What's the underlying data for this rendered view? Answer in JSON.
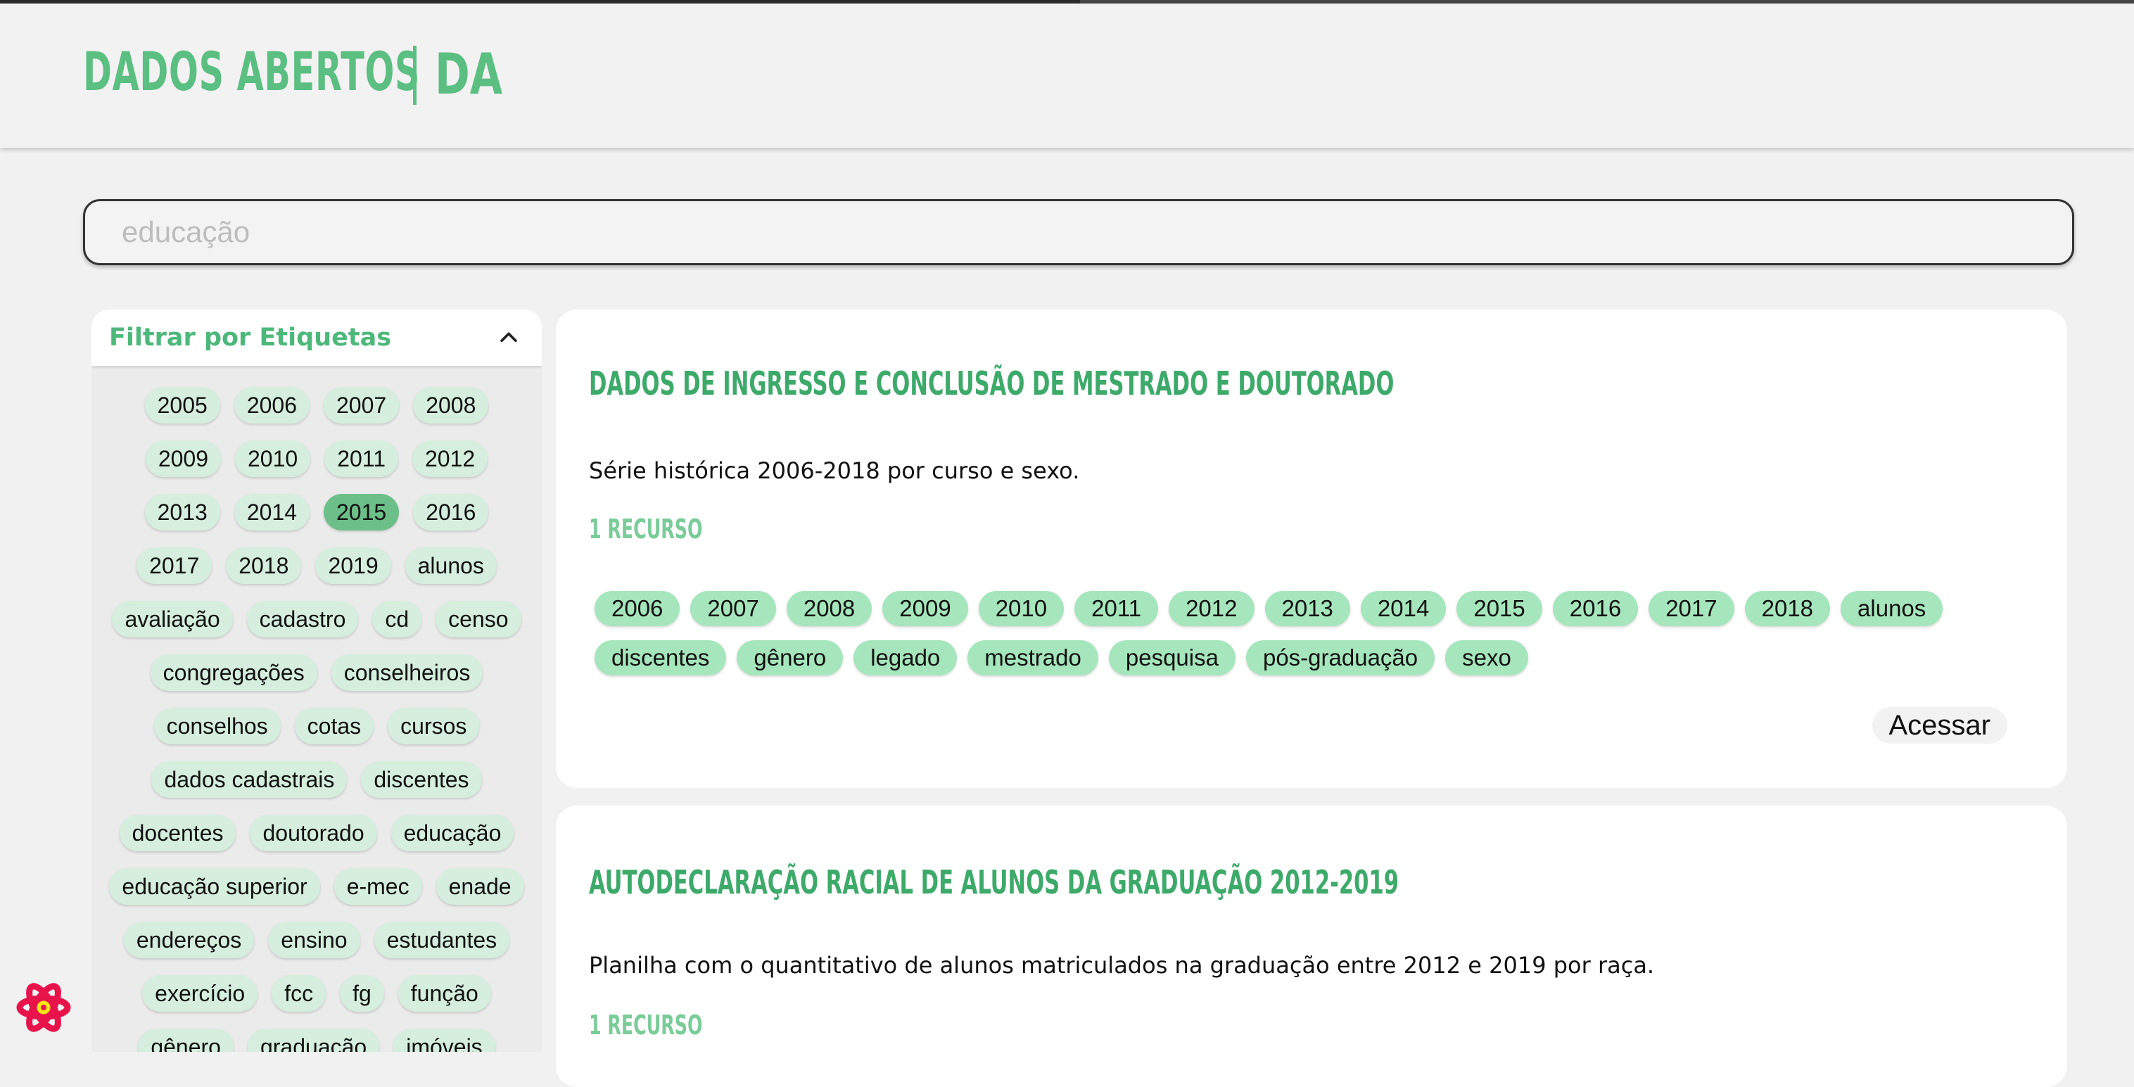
{
  "header": {
    "logo_text": "DADOS ABERTOS",
    "logo_mark": "DA"
  },
  "search": {
    "placeholder": "educação"
  },
  "filter": {
    "title": "Filtrar por Etiquetas",
    "active_tag": "2015",
    "tags": [
      "2005",
      "2006",
      "2007",
      "2008",
      "2009",
      "2010",
      "2011",
      "2012",
      "2013",
      "2014",
      "2015",
      "2016",
      "2017",
      "2018",
      "2019",
      "alunos",
      "avaliação",
      "cadastro",
      "cd",
      "censo",
      "congregações",
      "conselheiros",
      "conselhos",
      "cotas",
      "cursos",
      "dados cadastrais",
      "discentes",
      "docentes",
      "doutorado",
      "educação",
      "educação superior",
      "e-mec",
      "enade",
      "endereços",
      "ensino",
      "estudantes",
      "exercício",
      "fcc",
      "fg",
      "função",
      "gênero",
      "graduação",
      "imóveis"
    ]
  },
  "results": [
    {
      "title": "DADOS DE INGRESSO E CONCLUSÃO DE MESTRADO E DOUTORADO",
      "description": "Série histórica 2006-2018 por curso e sexo.",
      "resources": "1 RECURSO",
      "tags": [
        "2006",
        "2007",
        "2008",
        "2009",
        "2010",
        "2011",
        "2012",
        "2013",
        "2014",
        "2015",
        "2016",
        "2017",
        "2018",
        "alunos",
        "discentes",
        "gênero",
        "legado",
        "mestrado",
        "pesquisa",
        "pós-graduação",
        "sexo"
      ],
      "action": "Acessar"
    },
    {
      "title": "AUTODECLARAÇÃO RACIAL DE ALUNOS DA GRADUAÇÃO 2012-2019",
      "description": "Planilha com o quantitativo de alunos matriculados na graduação entre 2012 e 2019 por raça.",
      "resources": "1 RECURSO"
    }
  ],
  "colors": {
    "brand": "#5cbf82",
    "title": "#3daa6a",
    "tag": "#a6e6bd",
    "tag_active": "#6cbf89"
  }
}
